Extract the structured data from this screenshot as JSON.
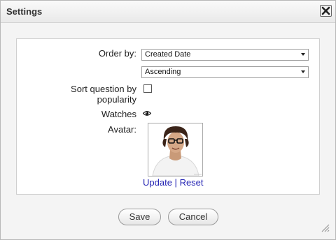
{
  "dialog": {
    "title": "Settings",
    "close_icon": "close-x-icon"
  },
  "form": {
    "order_by_label": "Order by:",
    "order_by_value": "Created Date",
    "order_direction_value": "Ascending",
    "sort_popularity_label_line1": "Sort question by",
    "sort_popularity_label_line2": "popularity",
    "sort_popularity_checked": false,
    "watches_label": "Watches",
    "watches_icon": "eye-icon",
    "avatar_label": "Avatar:",
    "avatar_icon": "avatar-photo",
    "update_link": "Update",
    "separator": "|",
    "reset_link": "Reset"
  },
  "buttons": {
    "save": "Save",
    "cancel": "Cancel"
  },
  "colors": {
    "link": "#2424b4",
    "panel_bg": "#ffffff",
    "dialog_bg": "#f4f4f4"
  }
}
